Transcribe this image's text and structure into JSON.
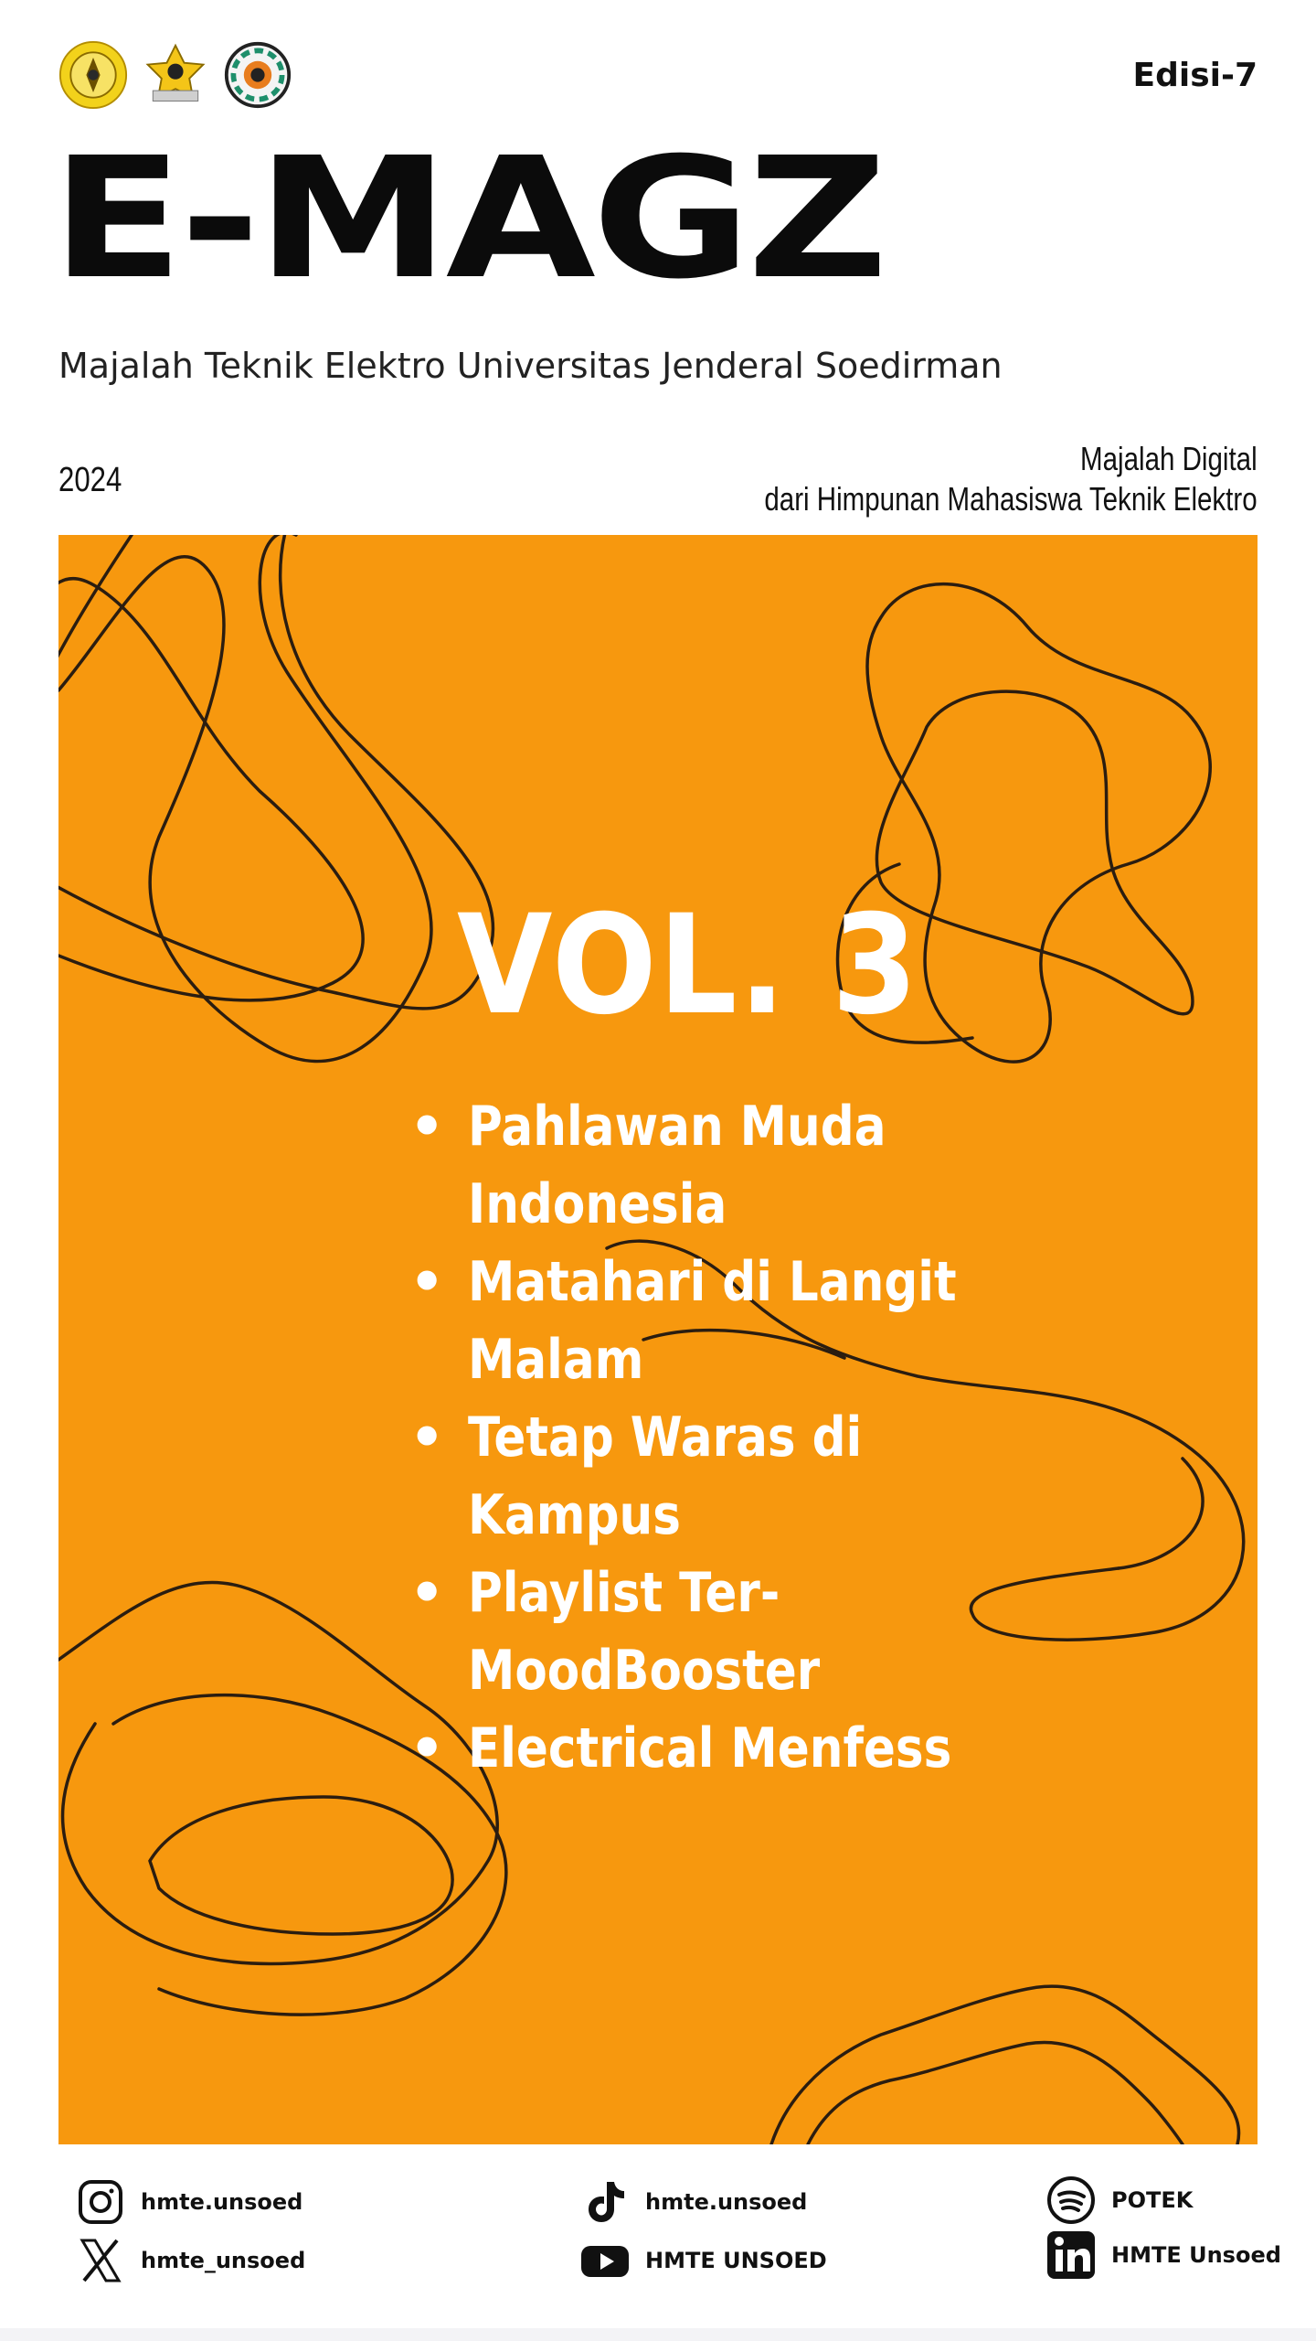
{
  "header": {
    "edition": "Edisi-7",
    "logos": [
      "university-seal-logo",
      "engineering-faculty-logo",
      "hmte-logo"
    ]
  },
  "masthead": {
    "title": "E-MAGZ",
    "subtitle": "Majalah Teknik Elektro Universitas Jenderal Soedirman"
  },
  "meta": {
    "year": "2024",
    "digital_line1": "Majalah Digital",
    "digital_line2": "dari Himpunan Mahasiswa Teknik Elektro"
  },
  "cover": {
    "background_color": "#f7980e",
    "volume": "VOL. 3",
    "topics": [
      {
        "line1": "Pahlawan Muda",
        "line2": "Indonesia"
      },
      {
        "line1": "Matahari di Langit",
        "line2": "Malam"
      },
      {
        "line1": "Tetap Waras di",
        "line2": "Kampus"
      },
      {
        "line1": "Playlist Ter-",
        "line2": "MoodBooster"
      },
      {
        "line1": "Electrical Menfess",
        "line2": ""
      }
    ]
  },
  "footer": {
    "instagram": {
      "icon": "instagram-icon",
      "handle": "hmte.unsoed"
    },
    "x": {
      "icon": "x-icon",
      "handle": "hmte_unsoed"
    },
    "tiktok": {
      "icon": "tiktok-icon",
      "handle": "hmte.unsoed"
    },
    "youtube": {
      "icon": "youtube-icon",
      "handle": "HMTE UNSOED"
    },
    "spotify": {
      "icon": "spotify-icon",
      "handle": "POTEK"
    },
    "linkedin": {
      "icon": "linkedin-icon",
      "handle": "HMTE Unsoed"
    }
  }
}
